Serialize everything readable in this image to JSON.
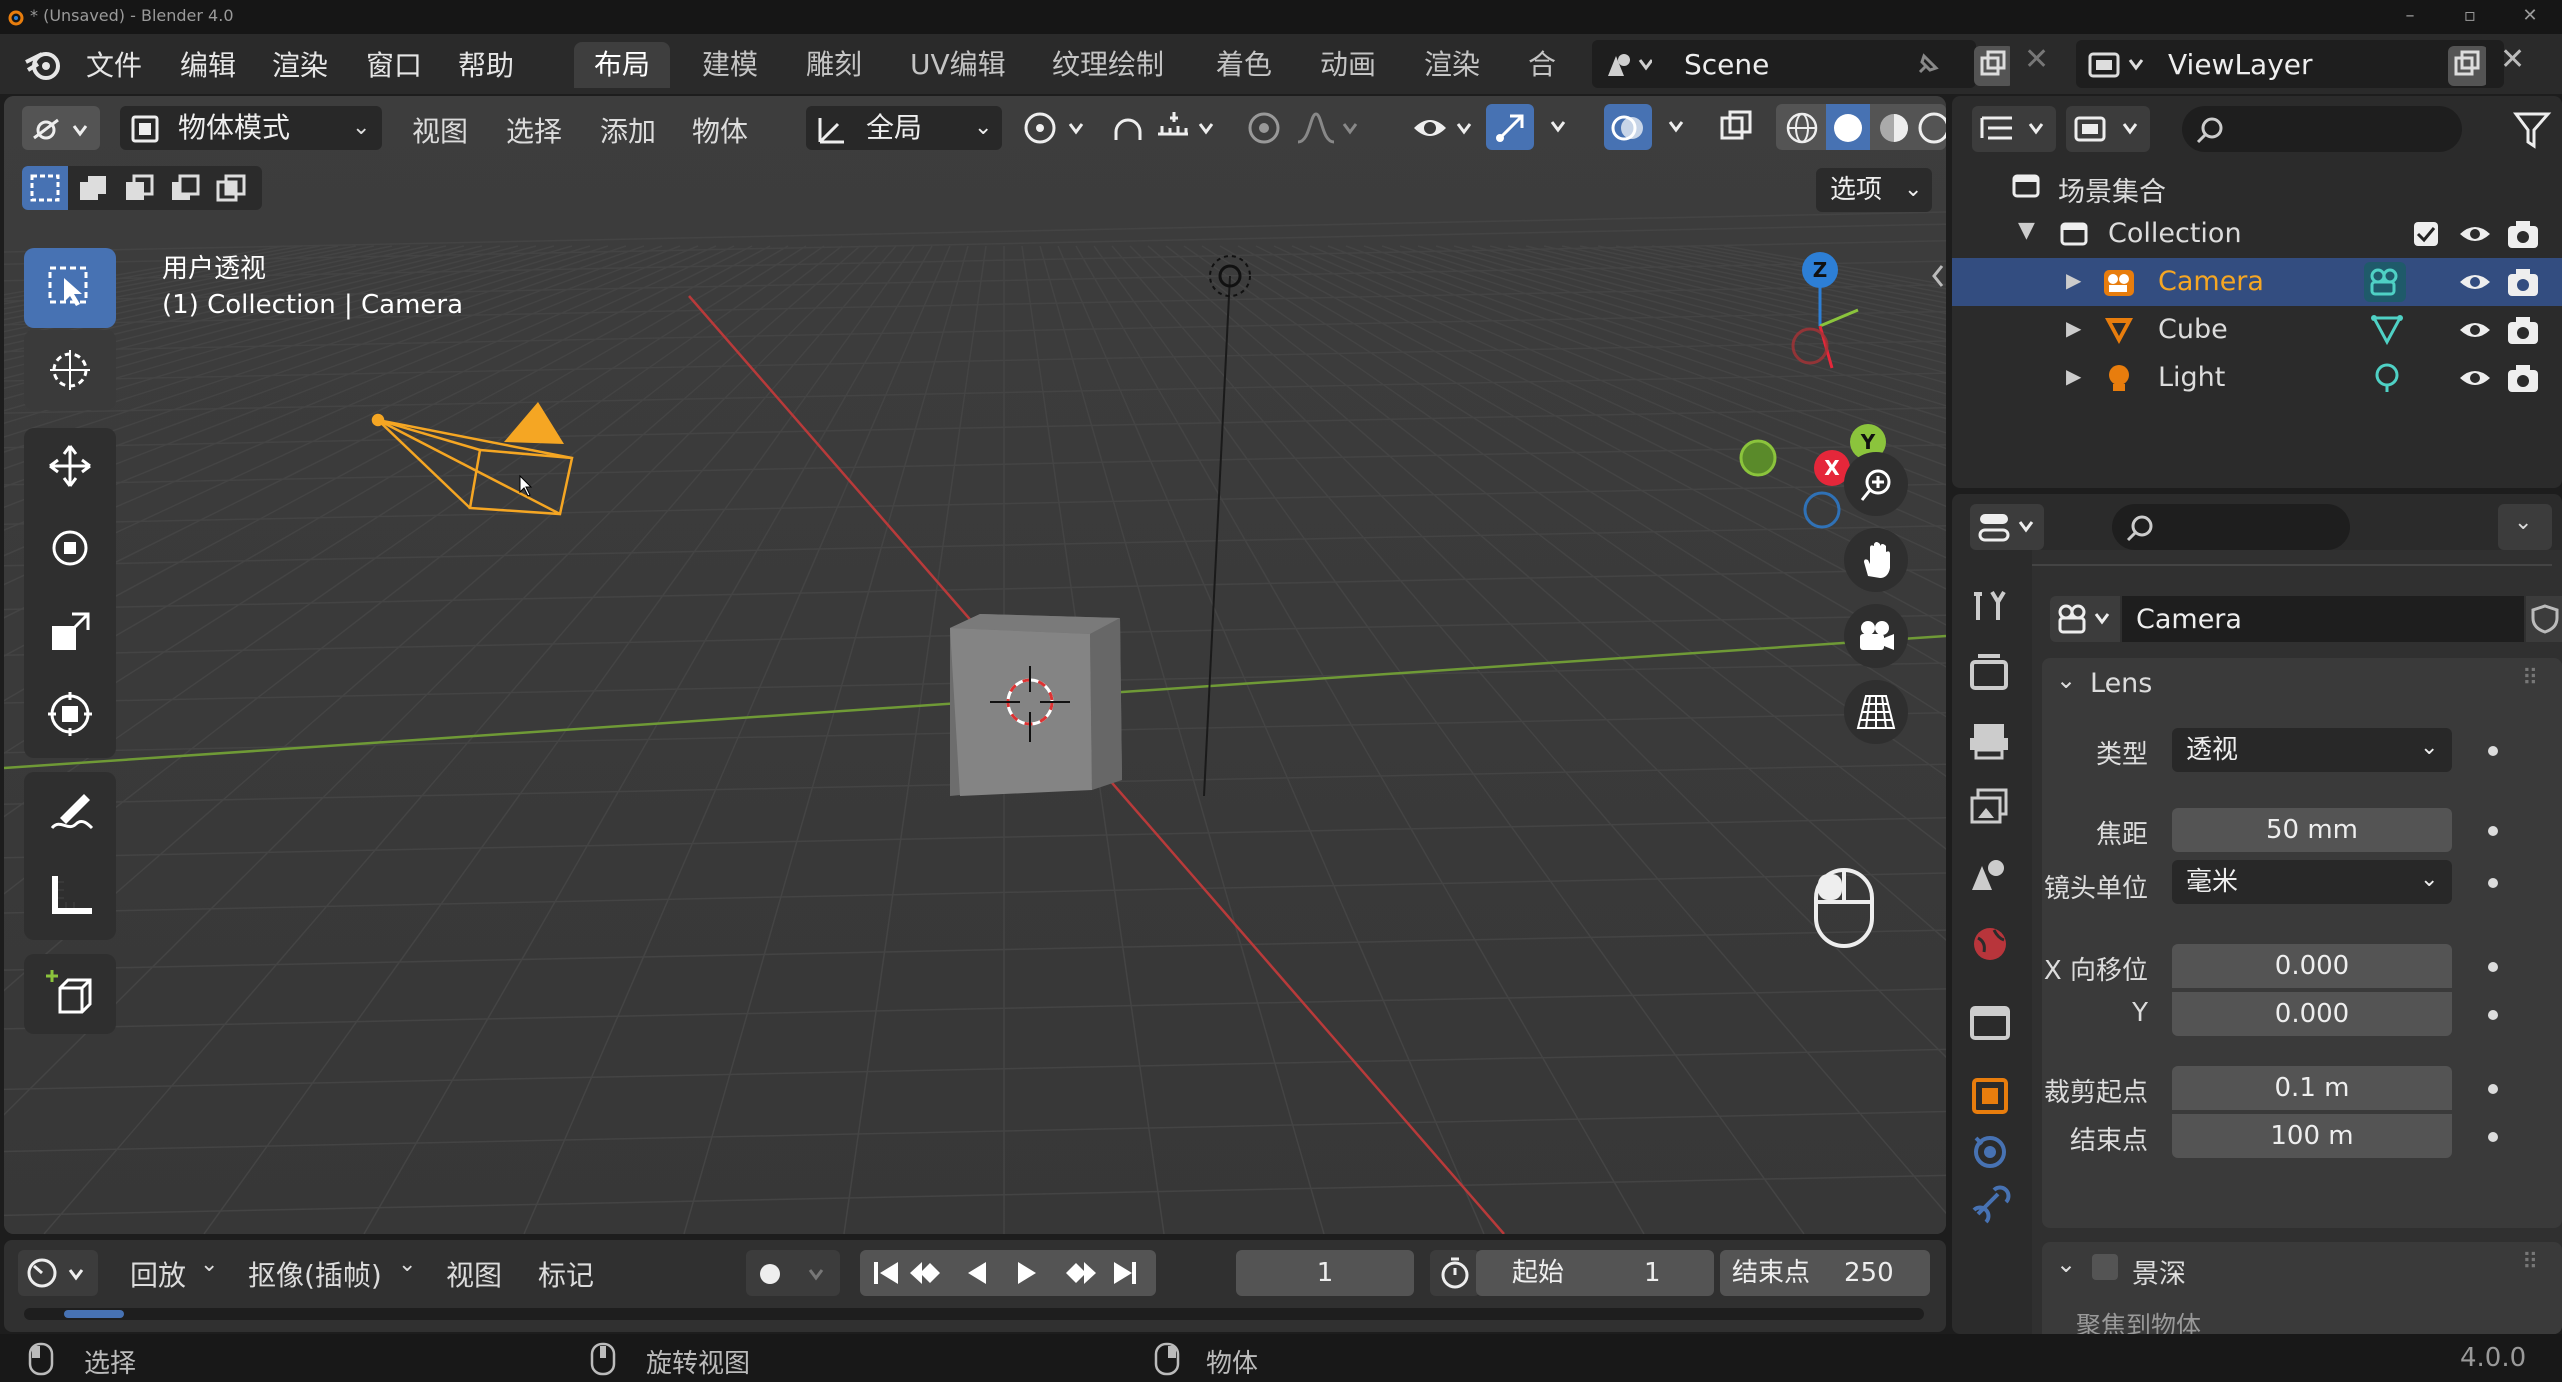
{
  "window": {
    "title": "* (Unsaved) - Blender 4.0"
  },
  "menubar": {
    "items": [
      "文件",
      "编辑",
      "渲染",
      "窗口",
      "帮助"
    ]
  },
  "workspaces": {
    "tabs": [
      "布局",
      "建模",
      "雕刻",
      "UV编辑",
      "纹理绘制",
      "着色",
      "动画",
      "渲染",
      "合成"
    ],
    "active": 0
  },
  "scene": {
    "name": "Scene"
  },
  "viewlayer": {
    "name": "ViewLayer"
  },
  "viewport_header": {
    "mode": "物体模式",
    "menus": [
      "视图",
      "选择",
      "添加",
      "物体"
    ],
    "orientation": "全局",
    "options_label": "选项"
  },
  "viewport": {
    "view_name": "用户透视",
    "context": "(1) Collection | Camera",
    "gizmo": {
      "z": "Z",
      "y": "Y",
      "x": "X"
    }
  },
  "timeline": {
    "menus": [
      "回放",
      "抠像(插帧)",
      "视图",
      "标记"
    ],
    "current_frame": "1",
    "start_label": "起始",
    "start_value": "1",
    "end_label": "结束点",
    "end_value": "250"
  },
  "statusbar": {
    "left": "选择",
    "middle": "旋转视图",
    "right": "物体",
    "version": "4.0.0"
  },
  "outliner": {
    "root": "场景集合",
    "collection": "Collection",
    "items": [
      {
        "name": "Camera",
        "selected": true
      },
      {
        "name": "Cube",
        "selected": false
      },
      {
        "name": "Light",
        "selected": false
      }
    ]
  },
  "properties": {
    "object_name": "Camera",
    "lens_panel": "Lens",
    "type_label": "类型",
    "type_value": "透视",
    "focal_label": "焦距",
    "focal_value": "50 mm",
    "lens_unit_label": "镜头单位",
    "lens_unit_value": "毫米",
    "shift_x_label": "X 向移位",
    "shift_x_value": "0.000",
    "shift_y_label": "Y",
    "shift_y_value": "0.000",
    "clip_start_label": "裁剪起点",
    "clip_start_value": "0.1 m",
    "clip_end_label": "结束点",
    "clip_end_value": "100 m",
    "dof_panel": "景深",
    "focus_object_label": "聚焦到物体"
  },
  "colors": {
    "accent": "#4772b3",
    "selected_object": "#f5a623",
    "x_axis": "#e5273a",
    "y_axis": "#8bc43c",
    "z_axis": "#2d7fd6"
  }
}
